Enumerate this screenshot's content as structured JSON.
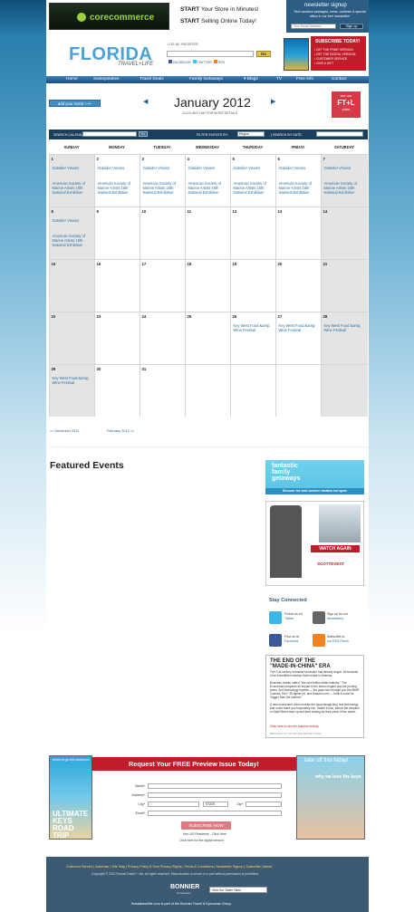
{
  "ad_top": {
    "logo_text": "corecommerce",
    "line1_bold": "START",
    "line1": "Your Store in Minutes!",
    "line2_bold": "START",
    "line2": "Selling Online Today!"
  },
  "newsletter": {
    "heading": "newsletter signup",
    "subtext": "Find vacation packages, news, contests & special offers in our free newsletter!",
    "email_placeholder": "Your Email Address",
    "button": "Sign up"
  },
  "header": {
    "logo_main": "FLORIDA",
    "logo_sub": "TRAVEL+LIFE",
    "login_text": "LOG IN / REGISTER",
    "search_button": "Go",
    "social_facebook": "FACEBOOK",
    "social_twitter": "TWITTER",
    "social_rss": "RSS",
    "subscribe_heading": "SUBSCRIBE TODAY!",
    "subscribe_lines": [
      "• GET THE PRINT VERSION",
      "• GET THE DIGITAL VERSION",
      "• CUSTOMER SERVICE",
      "• GIVE A GIFT"
    ]
  },
  "nav": {
    "items": [
      "Home",
      "Sweepstakes",
      "Travel Deals",
      "Family Getaways",
      "▾ Blogs",
      "TV",
      "Free Info",
      "Contact"
    ]
  },
  "calendar": {
    "add_event": "add your event +++",
    "month_title": "January 2012",
    "month_sub": "CLICK ANY DAY FOR MORE DETAILS",
    "prev_arrow": "◀",
    "next_arrow": "▶",
    "promo_top": "see our",
    "promo_mid": "FT+L",
    "promo_bottom": "picks",
    "search_label": "SEARCH CALENDAR",
    "search_go": "Go",
    "filter_label": "FILTER EVENTS BY:",
    "filter_value": "Region",
    "date_label": "| SEARCH BY DATE:",
    "days_of_week": [
      "SUNDAY",
      "MONDAY",
      "TUESDAY",
      "WEDNESDAY",
      "THURSDAY",
      "FRIDAY",
      "SATURDAY"
    ],
    "weeks": [
      [
        {
          "n": "1",
          "events": [
            "Outsider Visions",
            "American Society of Marine Artists 15th National Exhibition"
          ]
        },
        {
          "n": "2",
          "events": [
            "Outsider Visions",
            "American Society of Marine Artists 15th National Exhibition"
          ]
        },
        {
          "n": "3",
          "events": [
            "Outsider Visions",
            "American Society of Marine Artists 15th National Exhibition"
          ]
        },
        {
          "n": "4",
          "events": [
            "Outsider Visions",
            "American Society of Marine Artists 15th National Exhibition"
          ]
        },
        {
          "n": "5",
          "events": [
            "Outsider Visions",
            "American Society of Marine Artists 15th National Exhibition"
          ]
        },
        {
          "n": "6",
          "events": [
            "Outsider Visions",
            "American Society of Marine Artists 15th National Exhibition"
          ]
        },
        {
          "n": "7",
          "events": [
            "Outsider Visions",
            "American Society of Marine Artists 15th National Exhibition"
          ]
        }
      ],
      [
        {
          "n": "8",
          "events": [
            "Outsider Visions",
            "American Society of Marine Artists 15th National Exhibition"
          ]
        },
        {
          "n": "9",
          "events": []
        },
        {
          "n": "10",
          "events": []
        },
        {
          "n": "11",
          "events": []
        },
        {
          "n": "12",
          "events": []
        },
        {
          "n": "13",
          "events": []
        },
        {
          "n": "14",
          "events": []
        }
      ],
      [
        {
          "n": "15",
          "events": []
        },
        {
          "n": "16",
          "events": []
        },
        {
          "n": "17",
          "events": []
        },
        {
          "n": "18",
          "events": []
        },
        {
          "n": "19",
          "events": []
        },
        {
          "n": "20",
          "events": []
        },
        {
          "n": "21",
          "events": []
        }
      ],
      [
        {
          "n": "22",
          "events": []
        },
        {
          "n": "23",
          "events": []
        },
        {
          "n": "24",
          "events": []
        },
        {
          "n": "25",
          "events": []
        },
        {
          "n": "26",
          "events": [
            "Key West Food &amp; Wine Festival"
          ]
        },
        {
          "n": "27",
          "events": [
            "Key West Food &amp; Wine Festival"
          ]
        },
        {
          "n": "28",
          "events": [
            "Key West Food &amp; Wine Festival"
          ]
        }
      ],
      [
        {
          "n": "29",
          "events": [
            "Key West Food &amp; Wine Festival"
          ]
        },
        {
          "n": "30",
          "events": []
        },
        {
          "n": "31",
          "events": []
        },
        {
          "n": "",
          "events": []
        },
        {
          "n": "",
          "events": []
        },
        {
          "n": "",
          "events": []
        },
        {
          "n": "",
          "events": []
        }
      ]
    ],
    "prev_month": "<< December 2011",
    "next_month": "February 2012 >>"
  },
  "featured": {
    "heading": "Featured Events"
  },
  "sidebar": {
    "fam_line1": "fantastic",
    "fam_line2": "family",
    "fam_line3": "getaways",
    "fam_bar": "Discover the best summer vacation hot spots",
    "vest_watch": "WATCH AGAIN",
    "vest_brand": "SCOTTEVEST",
    "stay_connected": "Stay Connected",
    "twitter_text": "Follow us on",
    "twitter_link": "Twitter",
    "newsletter_text": "Sign up for our",
    "newsletter_link": "Newsletters",
    "facebook_text": "Find us on",
    "facebook_link": "Facebook",
    "rss_text": "Subscribe to",
    "rss_link": "our RSS Feeds",
    "mic_h1": "THE END OF THE",
    "mic_h2": "\"MADE-IN-CHINA\" ERA",
    "mic_p1": "The 21st century industrial revolution has already begun. All because of an incredible invention that's made in America.",
    "mic_p2": "Business Insider calls it \"the next trillion dollar industry.\" The Economist compares its impact to the steam engine and the printing press. And technology experts — the guys who brought you the IBM® 3-series, the F-35 fighter jet, and Amazon.com — think it could be \"bigger than the internet.\"",
    "mic_p3": "A new investment video reveals the (surprisingly tiny) real technology that could make you impossibly rich. Watch it now, before the skeptics on Wall Street wise up and start looking for their piece of the action.",
    "mic_link": "Click here to see the surprise ending",
    "mic_foot": "BROUGHT TO YOU BY THE MOTLEY FOOL"
  },
  "subscribe_bottom": {
    "banner": "Request Your FREE Preview Issue Today!",
    "mag1_text": "where to go this weekend!",
    "mag1_headline": "ULTIMATE KEYS ROAD TRIP",
    "mag2_text": "take off this friday!",
    "mag2_headline": "why we love the keys",
    "fields": [
      "Name*",
      "Address*",
      "City*",
      "Email*"
    ],
    "state_label": "STATE",
    "zip_label": "Zip*",
    "button": "SUBSCRIBE NOW",
    "note1": "Non-US Residents - Click Here",
    "note2": "Click here for the digital version"
  },
  "footer": {
    "links": "Customer Service | Advertise | Site Map | Privacy Policy & Your Privacy Rights | Terms & Conditions | Newsletter Signup | Subscribe | About",
    "copyright": "Copyright © 2012 Florida Travel + Life. All rights reserved. Reproduction in whole or in part without permission is prohibited.",
    "bonnier": "BONNIER",
    "bonnier_sub": "Corporation",
    "sister_sites": "Visit Our Sister Sites",
    "tagline": "floridatravellife.com is part of the Bonnier Travel & Epicurean Group"
  }
}
